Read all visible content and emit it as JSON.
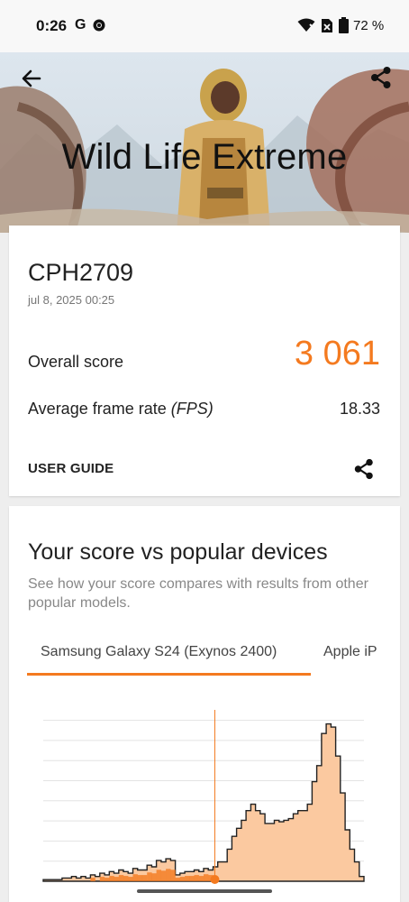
{
  "status_bar": {
    "time": "0:26",
    "g_icon": "G",
    "battery_pct": "72 %"
  },
  "hero": {
    "title": "Wild Life Extreme",
    "back_icon": "arrow-back-icon",
    "share_icon": "share-icon"
  },
  "result": {
    "device": "CPH2709",
    "date": "jul 8, 2025 00:25",
    "overall_label": "Overall score",
    "overall_score": "3 061",
    "fps_label_prefix": "Average frame rate ",
    "fps_label_unit": "(FPS)",
    "fps_value": "18.33",
    "user_guide": "USER GUIDE",
    "share_icon": "share-icon"
  },
  "compare": {
    "title": "Your score vs popular devices",
    "description": "See how your score compares with results from other popular models.",
    "tabs": [
      {
        "label": "Samsung Galaxy S24 (Exynos 2400)",
        "selected": true
      },
      {
        "label": "Apple iP",
        "selected": false
      }
    ]
  },
  "colors": {
    "accent": "#f47a1f",
    "histogram_fill": "#fbc9a0",
    "histogram_stroke": "#222222"
  },
  "chart_data": {
    "type": "area",
    "title": "",
    "xlabel": "",
    "ylabel": "",
    "marker_value": 0.535,
    "series": [
      {
        "values": [
          0.01,
          0.01,
          0.01,
          0.01,
          0.02,
          0.02,
          0.03,
          0.02,
          0.03,
          0.02,
          0.04,
          0.03,
          0.05,
          0.04,
          0.06,
          0.05,
          0.07,
          0.06,
          0.05,
          0.08,
          0.07,
          0.07,
          0.1,
          0.09,
          0.13,
          0.12,
          0.14,
          0.13,
          0.04,
          0.05,
          0.06,
          0.06,
          0.07,
          0.06,
          0.08,
          0.07,
          0.09,
          0.12,
          0.12,
          0.2,
          0.28,
          0.33,
          0.38,
          0.44,
          0.48,
          0.44,
          0.42,
          0.36,
          0.36,
          0.38,
          0.37,
          0.38,
          0.39,
          0.42,
          0.44,
          0.44,
          0.48,
          0.62,
          0.72,
          0.92,
          0.98,
          0.96,
          0.78,
          0.55,
          0.32,
          0.2,
          0.12,
          0.03
        ]
      }
    ]
  }
}
